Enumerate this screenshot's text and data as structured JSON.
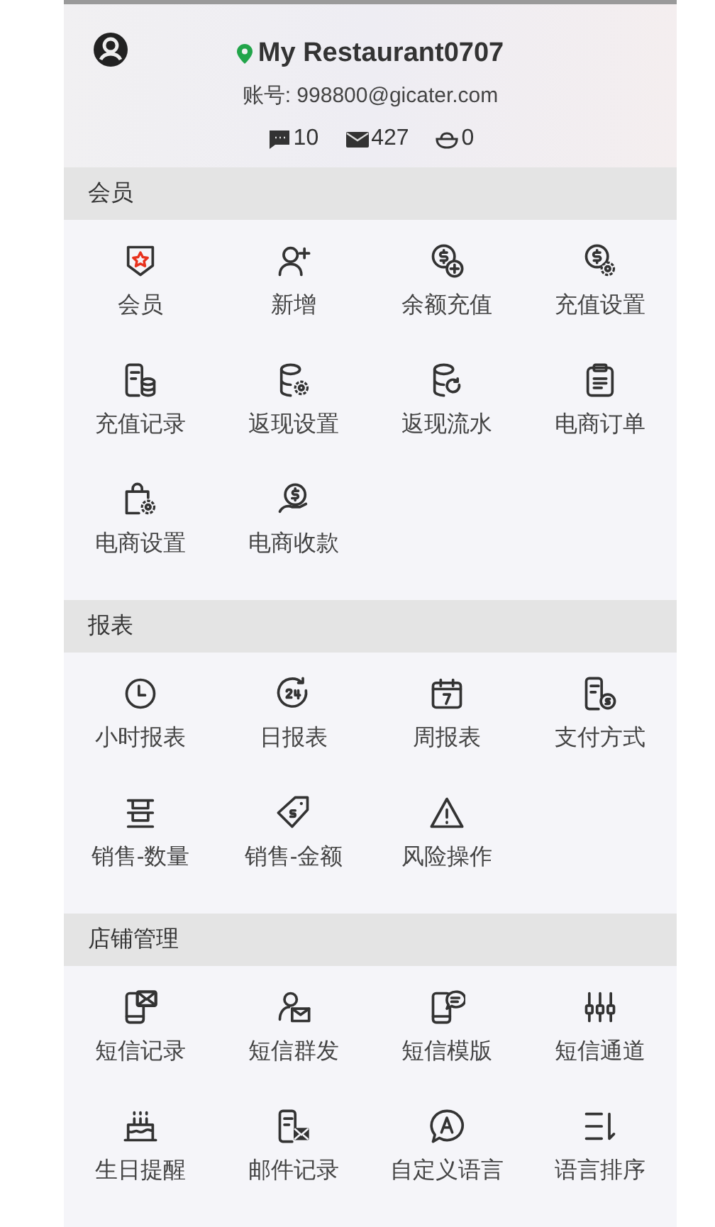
{
  "header": {
    "restaurant": "My Restaurant0707",
    "account": "账号: 998800@gicater.com",
    "counts": [
      "10",
      "427",
      "0"
    ]
  },
  "sections": [
    {
      "title": "会员",
      "items": [
        "会员",
        "新增",
        "余额充值",
        "充值设置",
        "充值记录",
        "返现设置",
        "返现流水",
        "电商订单",
        "电商设置",
        "电商收款"
      ]
    },
    {
      "title": "报表",
      "items": [
        "小时报表",
        "日报表",
        "周报表",
        "支付方式",
        "销售-数量",
        "销售-金额",
        "风险操作"
      ]
    },
    {
      "title": "店铺管理",
      "items": [
        "短信记录",
        "短信群发",
        "短信模版",
        "短信通道",
        "生日提醒",
        "邮件记录",
        "自定义语言",
        "语言排序"
      ]
    }
  ]
}
